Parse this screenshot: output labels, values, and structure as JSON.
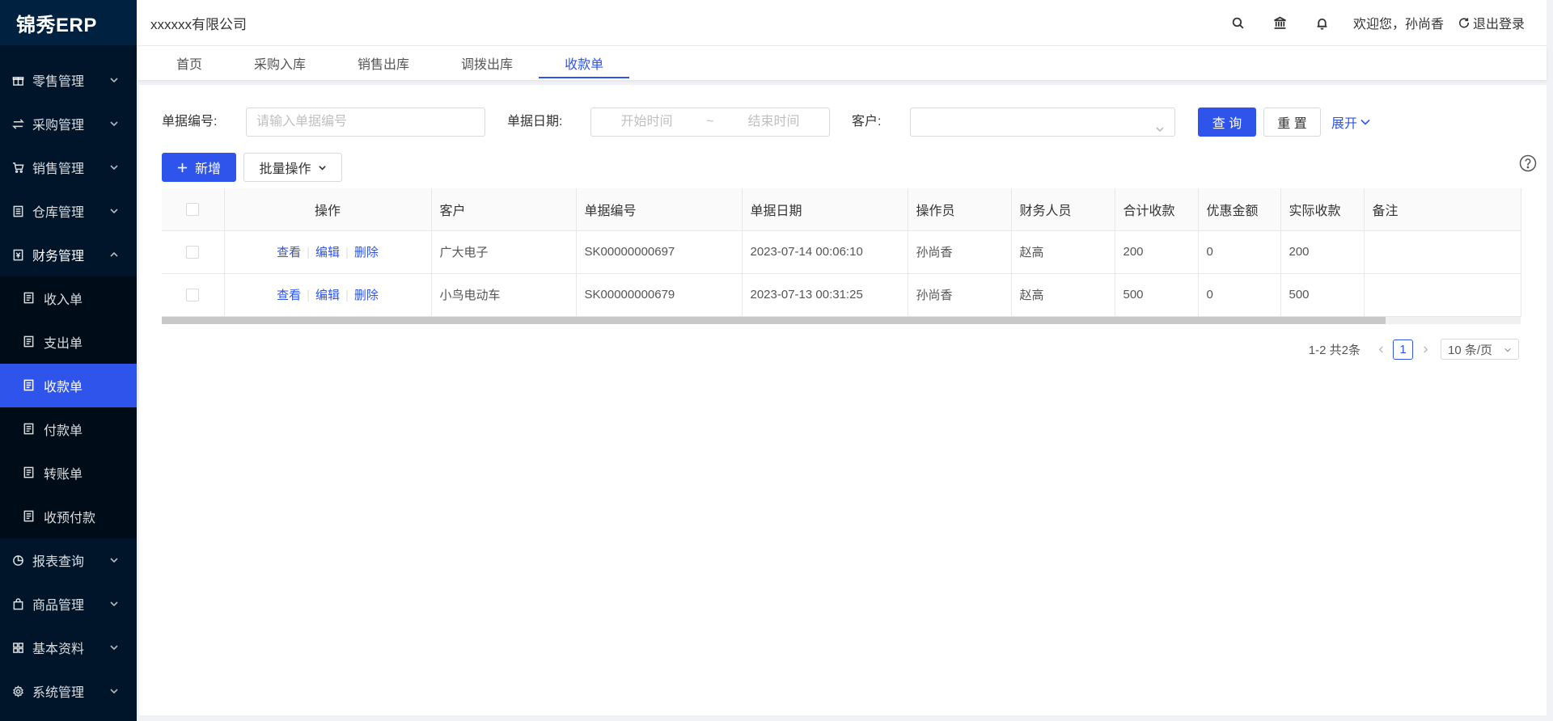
{
  "app": {
    "logo": "锦秀ERP",
    "company": "xxxxxx有限公司"
  },
  "header": {
    "welcome": "欢迎您，孙尚香",
    "logout": "退出登录"
  },
  "sidebar": {
    "items": [
      {
        "label": "零售管理",
        "icon": "gift-icon"
      },
      {
        "label": "采购管理",
        "icon": "swap-icon"
      },
      {
        "label": "销售管理",
        "icon": "cart-icon"
      },
      {
        "label": "仓库管理",
        "icon": "list-icon"
      },
      {
        "label": "财务管理",
        "icon": "account-book-icon"
      },
      {
        "label": "报表查询",
        "icon": "pie-chart-icon"
      },
      {
        "label": "商品管理",
        "icon": "shopping-icon"
      },
      {
        "label": "基本资料",
        "icon": "appstore-icon"
      },
      {
        "label": "系统管理",
        "icon": "setting-icon"
      }
    ],
    "sub_items": [
      {
        "label": "收入单"
      },
      {
        "label": "支出单"
      },
      {
        "label": "收款单"
      },
      {
        "label": "付款单"
      },
      {
        "label": "转账单"
      },
      {
        "label": "收预付款"
      }
    ]
  },
  "tabs": [
    {
      "label": "首页"
    },
    {
      "label": "采购入库"
    },
    {
      "label": "销售出库"
    },
    {
      "label": "调拨出库"
    },
    {
      "label": "收款单"
    }
  ],
  "filter": {
    "doc_no_label": "单据编号:",
    "doc_no_placeholder": "请输入单据编号",
    "date_label": "单据日期:",
    "date_start": "开始时间",
    "date_sep": "~",
    "date_end": "结束时间",
    "customer_label": "客户:",
    "customer_value": "",
    "query": "查 询",
    "reset": "重 置",
    "expand": "展开"
  },
  "toolbar": {
    "add": "新增",
    "batch": "批量操作"
  },
  "table": {
    "columns": [
      "操作",
      "客户",
      "单据编号",
      "单据日期",
      "操作员",
      "财务人员",
      "合计收款",
      "优惠金额",
      "实际收款",
      "备注"
    ],
    "actions": {
      "view": "查看",
      "edit": "编辑",
      "delete": "删除"
    },
    "rows": [
      {
        "customer": "广大电子",
        "doc_no": "SK00000000697",
        "date": "2023-07-14 00:06:10",
        "operator": "孙尚香",
        "finance": "赵高",
        "total": "200",
        "discount": "0",
        "actual": "200",
        "remark": ""
      },
      {
        "customer": "小鸟电动车",
        "doc_no": "SK00000000679",
        "date": "2023-07-13 00:31:25",
        "operator": "孙尚香",
        "finance": "赵高",
        "total": "500",
        "discount": "0",
        "actual": "500",
        "remark": ""
      }
    ]
  },
  "pagination": {
    "total": "1-2 共2条",
    "current": "1",
    "page_size": "10 条/页"
  },
  "colors": {
    "primary": "#2f54eb",
    "sidebar": "#001529",
    "submenu": "#000c17"
  }
}
